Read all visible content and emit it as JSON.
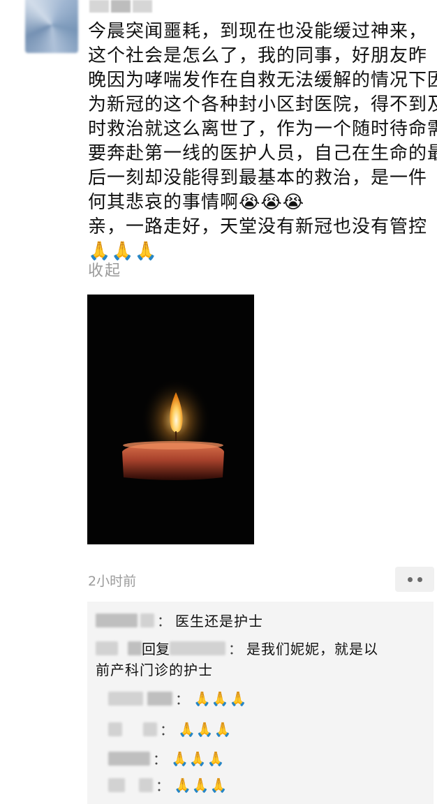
{
  "post": {
    "lines": [
      "今晨突闻噩耗，到现在也没能缓过神来，",
      "这个社会是怎么了，我的同事，好朋友昨",
      "晚因为哮喘发作在自救无法缓解的情况下因",
      "为新冠的这个各种封小区封医院，得不到及",
      "时救治就这么离世了，作为一个随时待命需",
      "要奔赴第一线的医护人员，自己在生命的最",
      "后一刻却没能得到最基本的救治，是一件",
      "何其悲哀的事情啊",
      "亲，一路走好，天堂没有新冠也没有管控"
    ],
    "crying_emojis": "😭😭😭",
    "pray_emojis": "🙏🙏🙏",
    "collapse_label": "收起",
    "time": "2小时前"
  },
  "comments": [
    {
      "text": "医生还是护士"
    },
    {
      "reply_word": "回复",
      "text_line1": "是我们妮妮，就是以",
      "text_line2": "前产科门诊的护士"
    },
    {
      "text": "🙏🙏🙏"
    },
    {
      "text": "🙏🙏🙏"
    },
    {
      "text": "🙏🙏🙏"
    },
    {
      "text": "🙏🙏🙏"
    }
  ],
  "icons": {
    "more": "more-dots-icon"
  },
  "colors": {
    "photo_bg": "#030303",
    "flame": "#ffb84a",
    "candle": "#c0523a",
    "comment_bg": "#f4f4f4",
    "meta_gray": "#9b9b9b"
  }
}
